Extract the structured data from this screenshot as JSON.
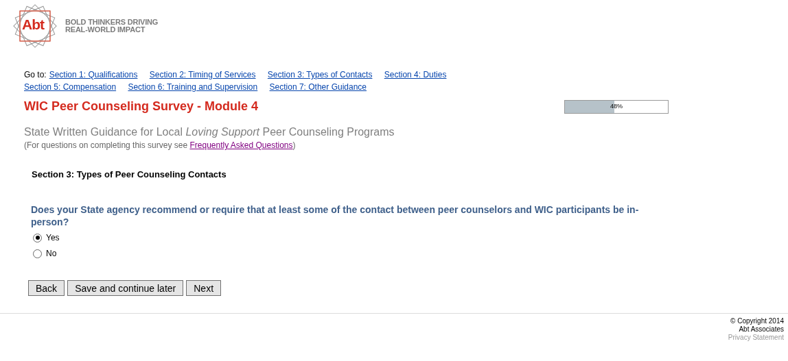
{
  "logo": {
    "mark": "Abt",
    "tagline": [
      "BOLD THINKERS DRIVING",
      "REAL-WORLD IMPACT"
    ]
  },
  "nav": {
    "label": "Go to:",
    "links": [
      "Section 1: Qualifications",
      "Section 2: Timing of Services",
      "Section 3: Types of Contacts",
      "Section 4: Duties",
      "Section 5: Compensation",
      "Section 6: Training and Supervision",
      "Section 7: Other Guidance"
    ]
  },
  "title": "WIC Peer Counseling Survey - Module 4",
  "progress": {
    "level": 0.48,
    "reading": "48%"
  },
  "subtitle": "State Written Guidance for Local *Loving Support* Peer Counseling Programs",
  "note": {
    "before": "(For questions on completing this survey see ",
    "link": "Frequently Asked Questions",
    "after": ")"
  },
  "section_heading": "Section 3: Types of Peer Counseling Contacts",
  "question": "Does your State agency recommend or require that at least some of the contact between peer counselors and WIC participants be in-person?",
  "options": [
    {
      "label": "Yes",
      "selected": true
    },
    {
      "label": "No",
      "selected": false
    }
  ],
  "buttons": [
    "Back",
    "Save and continue later",
    "Next"
  ],
  "footer": {
    "copyright": "© Copyright 2014",
    "company": "Abt Associates",
    "link": "Privacy Statement"
  }
}
